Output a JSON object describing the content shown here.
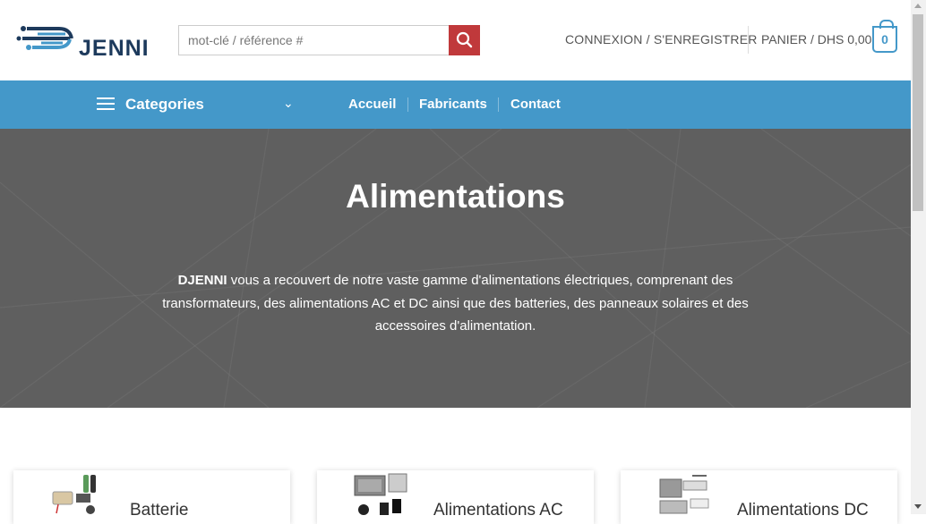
{
  "header": {
    "logo_text": "JENNI",
    "search": {
      "placeholder": "mot-clé / référence #"
    },
    "login_label": "CONNEXION / S'ENREGISTRER",
    "cart_label": "PANIER / DHS 0,00",
    "cart_count": "0"
  },
  "nav": {
    "categories_label": "Categories",
    "links": [
      "Accueil",
      "Fabricants",
      "Contact"
    ]
  },
  "hero": {
    "title": "Alimentations",
    "brand": "DJENNI",
    "description": " vous a recouvert de notre vaste gamme d'alimentations électriques, comprenant des transformateurs, des alimentations AC et DC ainsi que des batteries, des panneaux solaires et des accessoires d'alimentation."
  },
  "products": [
    {
      "title": "Batterie"
    },
    {
      "title": "Alimentations AC"
    },
    {
      "title": "Alimentations DC"
    }
  ],
  "colors": {
    "nav": "#4498c9",
    "search_button": "#c0393b",
    "hero_bg": "#5f5f5f",
    "logo": "#1d3a5c"
  }
}
